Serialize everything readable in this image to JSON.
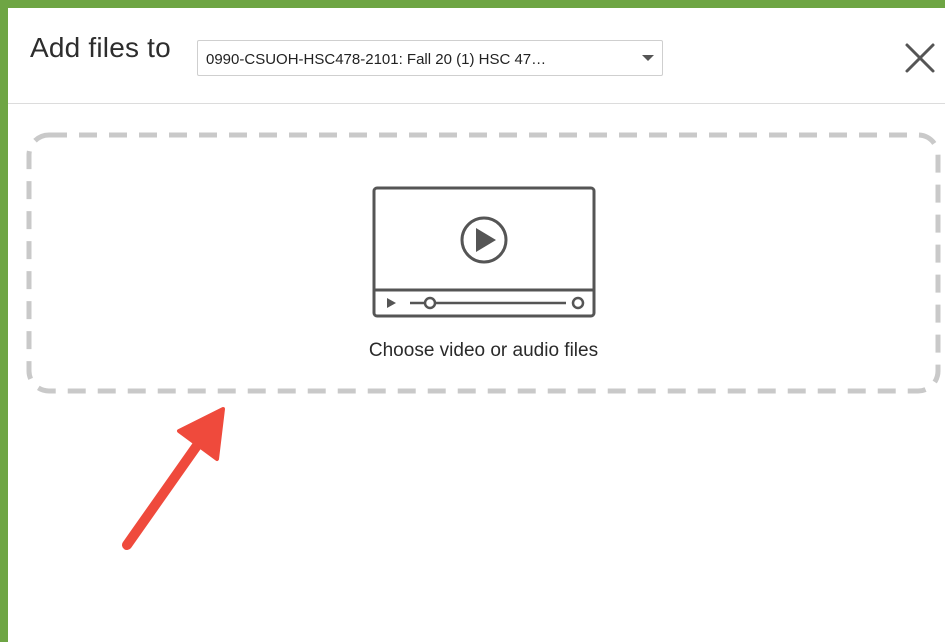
{
  "dialog": {
    "title": "Add files to",
    "destination_select": {
      "selected_value": "0990-CSUOH-HSC478-2101: Fall 20 (1) HSC 47…"
    },
    "close_icon": "close-icon"
  },
  "dropzone": {
    "label": "Choose video or audio files",
    "icon": "video-player-icon"
  },
  "annotation": {
    "arrow_icon": "arrow-icon",
    "arrow_color": "#ef4a3c"
  },
  "colors": {
    "frame_border": "#6ea544",
    "dropzone_border": "#c9c9c9",
    "icon_stroke": "#555555"
  }
}
